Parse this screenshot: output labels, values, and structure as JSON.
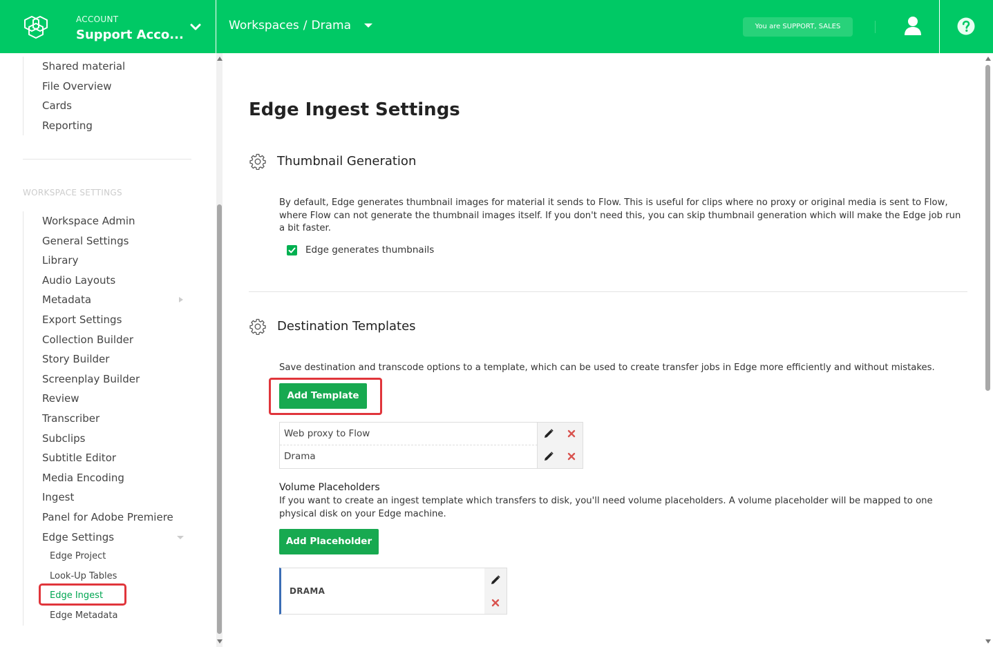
{
  "header": {
    "account_label": "ACCOUNT",
    "account_name": "Support Acco...",
    "breadcrumb": [
      "Workspaces",
      "/",
      "Drama"
    ],
    "role_badge": "You are SUPPORT, SALES",
    "icons": [
      "logo-icon",
      "chevron-down-icon",
      "caret-down-icon",
      "user-icon",
      "help-icon"
    ]
  },
  "sidebar": {
    "top_items": [
      {
        "label": "Shared material"
      },
      {
        "label": "File Overview"
      },
      {
        "label": "Cards"
      },
      {
        "label": "Reporting"
      }
    ],
    "section_heading": "WORKSPACE SETTINGS",
    "settings_items": [
      {
        "label": "Workspace Admin"
      },
      {
        "label": "General Settings"
      },
      {
        "label": "Library"
      },
      {
        "label": "Audio Layouts"
      },
      {
        "label": "Metadata"
      },
      {
        "label": "Export Settings"
      },
      {
        "label": "Collection Builder"
      },
      {
        "label": "Story Builder"
      },
      {
        "label": "Screenplay Builder"
      },
      {
        "label": "Review"
      },
      {
        "label": "Transcriber"
      },
      {
        "label": "Subclips"
      },
      {
        "label": "Subtitle Editor"
      },
      {
        "label": "Media Encoding"
      },
      {
        "label": "Ingest"
      },
      {
        "label": "Panel for Adobe Premiere"
      },
      {
        "label": "Edge Settings"
      }
    ],
    "edge_sub_items": [
      {
        "label": "Edge Project"
      },
      {
        "label": "Look-Up Tables"
      },
      {
        "label": "Edge Ingest",
        "active": true
      },
      {
        "label": "Edge Metadata"
      }
    ]
  },
  "main": {
    "title": "Edge Ingest Settings",
    "thumbnail": {
      "title": "Thumbnail Generation",
      "description": "By default, Edge generates thumbnail images for material it sends to Flow. This is useful for clips where no proxy or original media is sent to Flow, where Flow can not generate the thumbnail images itself. If you don't need this, you can skip thumbnail generation which will make the Edge job run a bit faster.",
      "checkbox_label": "Edge generates thumbnails",
      "checked": true
    },
    "templates": {
      "title": "Destination Templates",
      "description": "Save destination and transcode options to a template, which can be used to create transfer jobs in Edge more efficiently and without mistakes.",
      "add_button": "Add Template",
      "rows": [
        {
          "name": "Web proxy to Flow"
        },
        {
          "name": "Drama"
        }
      ]
    },
    "placeholders": {
      "title": "Volume Placeholders",
      "description": "If you want to create an ingest template which transfers to disk, you'll need volume placeholders. A volume placeholder will be mapped to one physical disk on your Edge machine.",
      "add_button": "Add Placeholder",
      "items": [
        {
          "name": "DRAMA"
        }
      ]
    }
  },
  "colors": {
    "brand_green": "#00c965",
    "button_green": "#17a950",
    "highlight_red": "#e0353b",
    "active_link": "#00a651"
  }
}
